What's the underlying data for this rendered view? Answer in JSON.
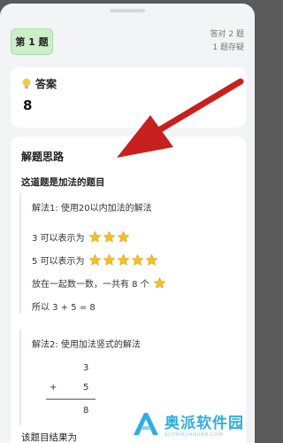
{
  "header": {
    "question_tab": "第 1 题",
    "stats_line1": "答对 2 题",
    "stats_line2": "1 题存疑"
  },
  "answer": {
    "title": "答案",
    "value": "8"
  },
  "solution": {
    "title": "解题思路",
    "subtitle": "这道题是加法的题目",
    "method1": {
      "title": "解法1: 使用20以内加法的解法",
      "line1": "3 可以表示为",
      "line1_stars": 3,
      "line2": "5 可以表示为",
      "line2_stars": 5,
      "line3": "放在一起数一数，一共有 8 个",
      "line3_stars": 1,
      "line4": "所以 3 + 5 = 8"
    },
    "method2": {
      "title": "解法2: 使用加法竖式的解法",
      "top": "3",
      "op": "+",
      "bottom": "5",
      "result": "8"
    },
    "conclusion": "该题目结果为"
  },
  "colors": {
    "accent_green": "#cdeecb",
    "arrow_red": "#c8201e",
    "star_gold": "#f5bf2a",
    "watermark_blue": "#2eaee0"
  },
  "watermark": {
    "name": "奥派软件园",
    "url": "AOPAIRUANJIAN.COM"
  }
}
